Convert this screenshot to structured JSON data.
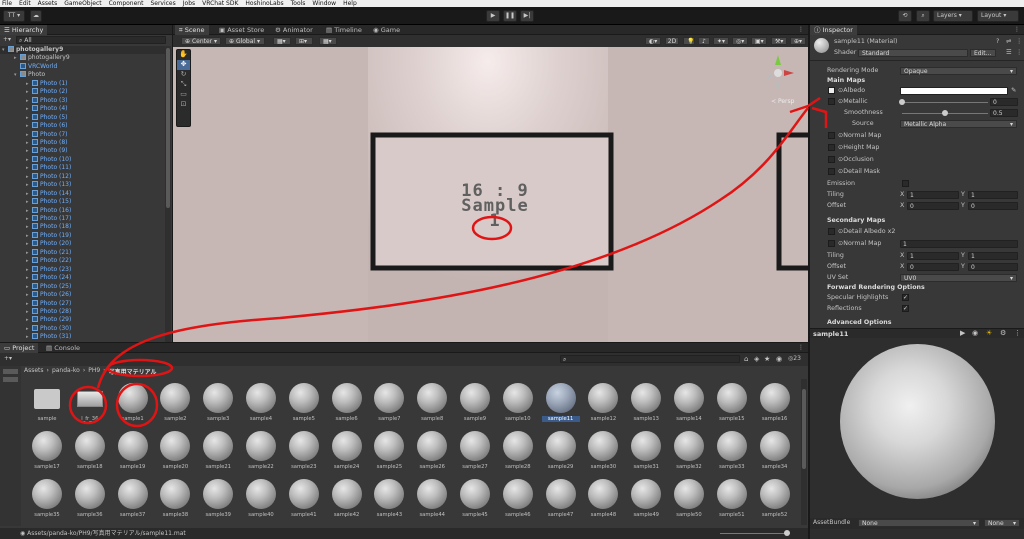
{
  "menu": [
    "File",
    "Edit",
    "Assets",
    "GameObject",
    "Component",
    "Services",
    "Jobs",
    "VRChat SDK",
    "HoshinoLabs",
    "Tools",
    "Window",
    "Help"
  ],
  "toolbar": {
    "account": "TT",
    "layers": "Layers",
    "layout": "Layout"
  },
  "hierarchy": {
    "title": "Hierarchy",
    "search_placeholder": "All",
    "root": "photogallery9",
    "child1": "photogallery9",
    "child2": "VRCWorld",
    "photo_parent": "Photo",
    "photos": [
      "Photo (1)",
      "Photo (2)",
      "Photo (3)",
      "Photo (4)",
      "Photo (5)",
      "Photo (6)",
      "Photo (7)",
      "Photo (8)",
      "Photo (9)",
      "Photo (10)",
      "Photo (11)",
      "Photo (12)",
      "Photo (13)",
      "Photo (14)",
      "Photo (15)",
      "Photo (16)",
      "Photo (17)",
      "Photo (18)",
      "Photo (19)",
      "Photo (20)",
      "Photo (21)",
      "Photo (22)",
      "Photo (23)",
      "Photo (24)",
      "Photo (25)",
      "Photo (26)",
      "Photo (27)",
      "Photo (28)",
      "Photo (29)",
      "Photo (30)",
      "Photo (31)"
    ]
  },
  "scene": {
    "tabs": [
      "Scene",
      "Asset Store",
      "Animator",
      "Timeline",
      "Game"
    ],
    "pivot": "Center",
    "space": "Global",
    "mode_2d": "2D",
    "persp": "Persp",
    "frame_text_line1": "16 : 9",
    "frame_text_line2": "Sample",
    "frame_text_line3": "1",
    "colors": {
      "annotation": "#e01414",
      "frame": "#1a1a1a"
    }
  },
  "inspector": {
    "tab": "Inspector",
    "material_name": "sample11 (Material)",
    "shader_label": "Shader",
    "shader_value": "Standard",
    "edit_button": "Edit...",
    "rendering_mode_label": "Rendering Mode",
    "rendering_mode_value": "Opaque",
    "main_maps": "Main Maps",
    "albedo": "Albedo",
    "metallic": "Metallic",
    "metallic_value": "0",
    "smoothness": "Smoothness",
    "smoothness_value": "0.5",
    "source": "Source",
    "source_value": "Metallic Alpha",
    "normal_map": "Normal Map",
    "height_map": "Height Map",
    "occlusion": "Occlusion",
    "detail_mask": "Detail Mask",
    "emission": "Emission",
    "tiling": "Tiling",
    "offset": "Offset",
    "tiling_x": "1",
    "tiling_y": "1",
    "offset_x": "0",
    "offset_y": "0",
    "x": "X",
    "y": "Y",
    "secondary_maps": "Secondary Maps",
    "detail_albedo": "Detail Albedo x2",
    "normal_map2": "Normal Map",
    "normal_map2_value": "1",
    "tiling2_x": "1",
    "tiling2_y": "1",
    "offset2_x": "0",
    "offset2_y": "0",
    "uv_set": "UV Set",
    "uv_set_value": "UV0",
    "forward_options": "Forward Rendering Options",
    "specular_highlights": "Specular Highlights",
    "reflections": "Reflections",
    "advanced_options": "Advanced Options"
  },
  "preview": {
    "title": "sample11",
    "assetbundle_label": "AssetBundle",
    "assetbundle_value": "None",
    "variant_value": "None"
  },
  "project": {
    "tabs": [
      "Project",
      "Console"
    ],
    "breadcrumb": [
      "Assets",
      "panda-ko",
      "PH9",
      "写真用マテリアル"
    ],
    "count": "23",
    "status_path": "Assets/panda-ko/PH9/写真用マテリアル/sample11.mat",
    "folder_label": "sample",
    "texture_label": "l_fr_36",
    "row1": [
      "sample1",
      "sample2",
      "sample3",
      "sample4",
      "sample5",
      "sample6",
      "sample7",
      "sample8",
      "sample9",
      "sample10",
      "sample11",
      "sample12",
      "sample13",
      "sample14",
      "sample15",
      "sample16"
    ],
    "row2": [
      "sample17",
      "sample18",
      "sample19",
      "sample20",
      "sample21",
      "sample22",
      "sample23",
      "sample24",
      "sample25",
      "sample26",
      "sample27",
      "sample28",
      "sample29",
      "sample30",
      "sample31",
      "sample32",
      "sample33",
      "sample34"
    ],
    "row3": [
      "sample35",
      "sample36",
      "sample37",
      "sample38",
      "sample39",
      "sample40",
      "sample41",
      "sample42",
      "sample43",
      "sample44",
      "sample45",
      "sample46",
      "sample47",
      "sample48",
      "sample49",
      "sample50",
      "sample51",
      "sample52"
    ],
    "selected": "sample11"
  }
}
